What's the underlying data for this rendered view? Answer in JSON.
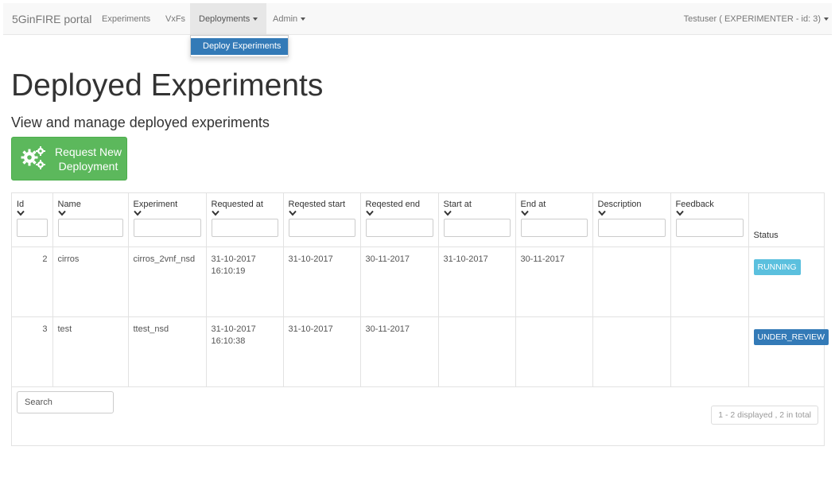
{
  "navbar": {
    "brand": "5GinFIRE portal",
    "items": [
      {
        "label": "Experiments"
      },
      {
        "label": "VxFs"
      },
      {
        "label": "Deployments"
      },
      {
        "label": "Admin"
      }
    ],
    "user": "Testuser ( EXPERIMENTER - id: 3)"
  },
  "dropdown": {
    "items": [
      {
        "label": "Deploy Experiments"
      }
    ]
  },
  "page": {
    "title": "Deployed Experiments",
    "subtitle": "View and manage deployed experiments",
    "request_button": {
      "line1": "Request New",
      "line2": "Deployment",
      "icon": "gears-icon"
    }
  },
  "table": {
    "columns": [
      "Id",
      "Name",
      "Experiment",
      "Requested at",
      "Reqested start",
      "Reqested end",
      "Start at",
      "End at",
      "Description",
      "Feedback",
      "Status"
    ],
    "rows": [
      {
        "id": "2",
        "name": "cirros",
        "experiment": "cirros_2vnf_nsd",
        "requested_at": [
          "31-10-2017",
          "16:10:19"
        ],
        "req_start": "31-10-2017",
        "req_end": "30-11-2017",
        "start_at": "31-10-2017",
        "end_at": "30-11-2017",
        "description": "",
        "feedback": "",
        "status": "RUNNING"
      },
      {
        "id": "3",
        "name": "test",
        "experiment": "ttest_nsd",
        "requested_at": [
          "31-10-2017",
          "16:10:38"
        ],
        "req_start": "31-10-2017",
        "req_end": "30-11-2017",
        "start_at": "",
        "end_at": "",
        "description": "",
        "feedback": "",
        "status": "UNDER_REVIEW"
      }
    ],
    "search_placeholder": "Search",
    "pager_info": "1 - 2 displayed , 2 in total"
  },
  "colors": {
    "success": "#5cb85c",
    "info": "#5bc0de",
    "primary": "#337ab7"
  }
}
